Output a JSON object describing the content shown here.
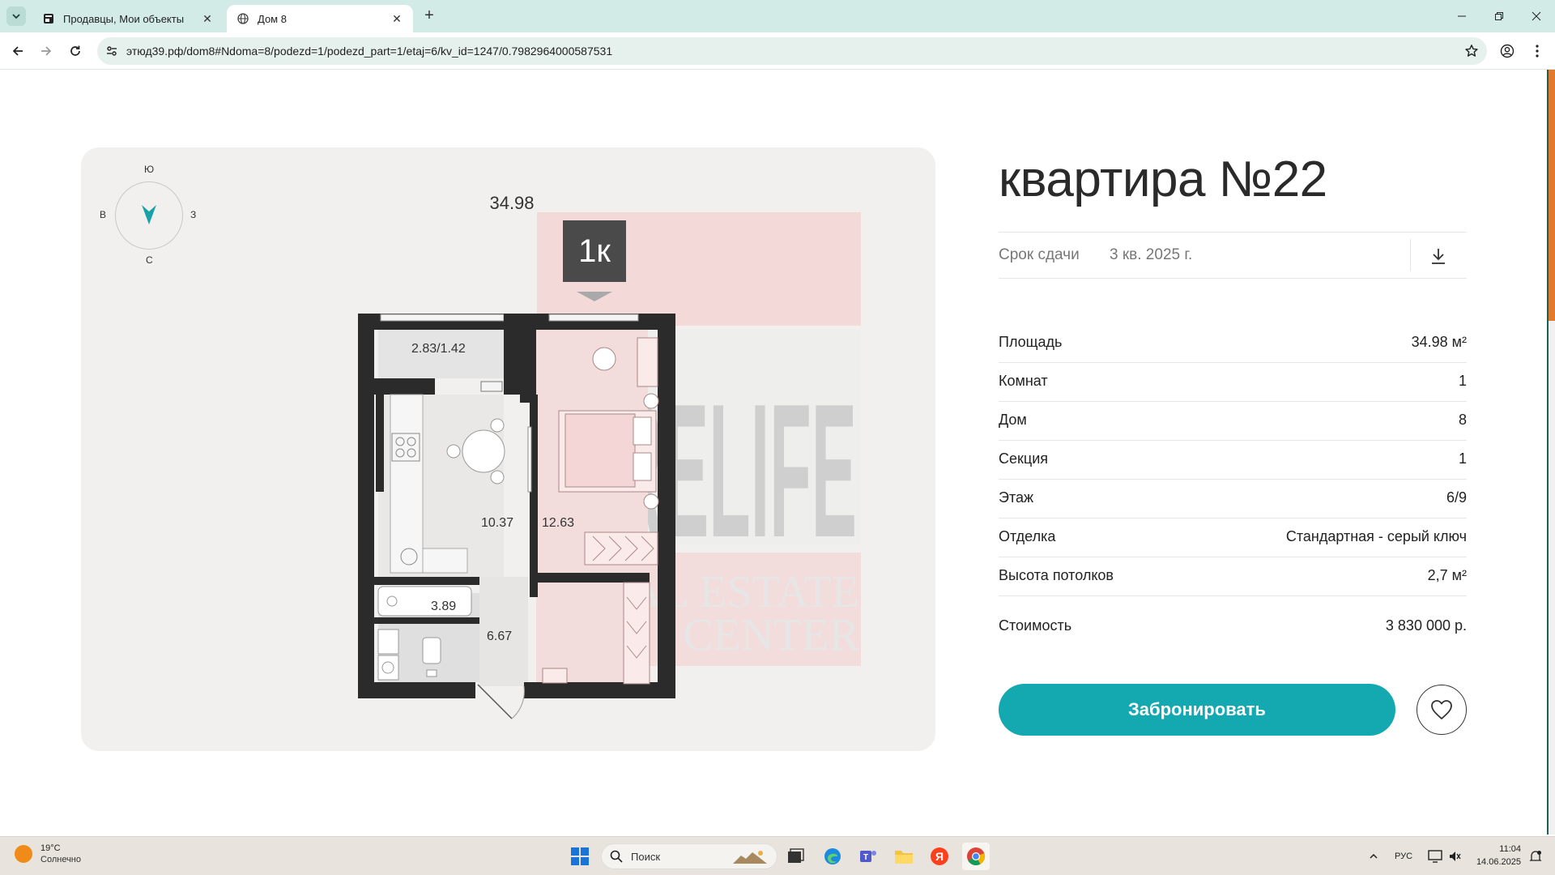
{
  "browser": {
    "tabs": [
      {
        "label": "Продавцы, Мои объекты",
        "active": false
      },
      {
        "label": "Дом 8",
        "active": true
      }
    ],
    "url": "этюд39.рф/dom8#Ndoma=8/podezd=1/podezd_part=1/etaj=6/kv_id=1247/0.7982964000587531"
  },
  "plan": {
    "compass": {
      "south": "Ю",
      "north": "С",
      "west": "В",
      "east": "З"
    },
    "total_area": "34.98",
    "rooms_badge": "1к",
    "room_areas": {
      "balcony": "2.83/1.42",
      "kitchen": "10.37",
      "bedroom": "12.63",
      "bathroom": "3.89",
      "hallway": "6.67"
    },
    "watermark": {
      "logo": "RELIFE",
      "line1": "REAL ESTATE",
      "line2": "CENTER"
    }
  },
  "apartment": {
    "title": "квартира №22",
    "delivery_label": "Срок сдачи",
    "delivery_value": "3 кв. 2025 г.",
    "specs": [
      {
        "label": "Площадь",
        "value": "34.98 м²"
      },
      {
        "label": "Комнат",
        "value": "1"
      },
      {
        "label": "Дом",
        "value": "8"
      },
      {
        "label": "Секция",
        "value": "1"
      },
      {
        "label": "Этаж",
        "value": "6/9"
      },
      {
        "label": "Отделка",
        "value": "Стандартная - серый ключ"
      },
      {
        "label": "Высота потолков",
        "value": "2,7 м²"
      }
    ],
    "price_label": "Стоимость",
    "price_value": "3 830 000 р.",
    "book_button": "Забронировать"
  },
  "taskbar": {
    "weather_temp": "19°C",
    "weather_desc": "Солнечно",
    "search_placeholder": "Поиск",
    "language": "РУС",
    "time": "11:04",
    "date": "14.06.2025"
  },
  "colors": {
    "accent": "#14a9b0",
    "compass_arrow": "#17a2a8",
    "wall": "#2b2b2b",
    "highlight_room": "#f3dcdc",
    "tabstrip": "#d3ebe6",
    "scroll_thumb": "#e07a2c"
  }
}
